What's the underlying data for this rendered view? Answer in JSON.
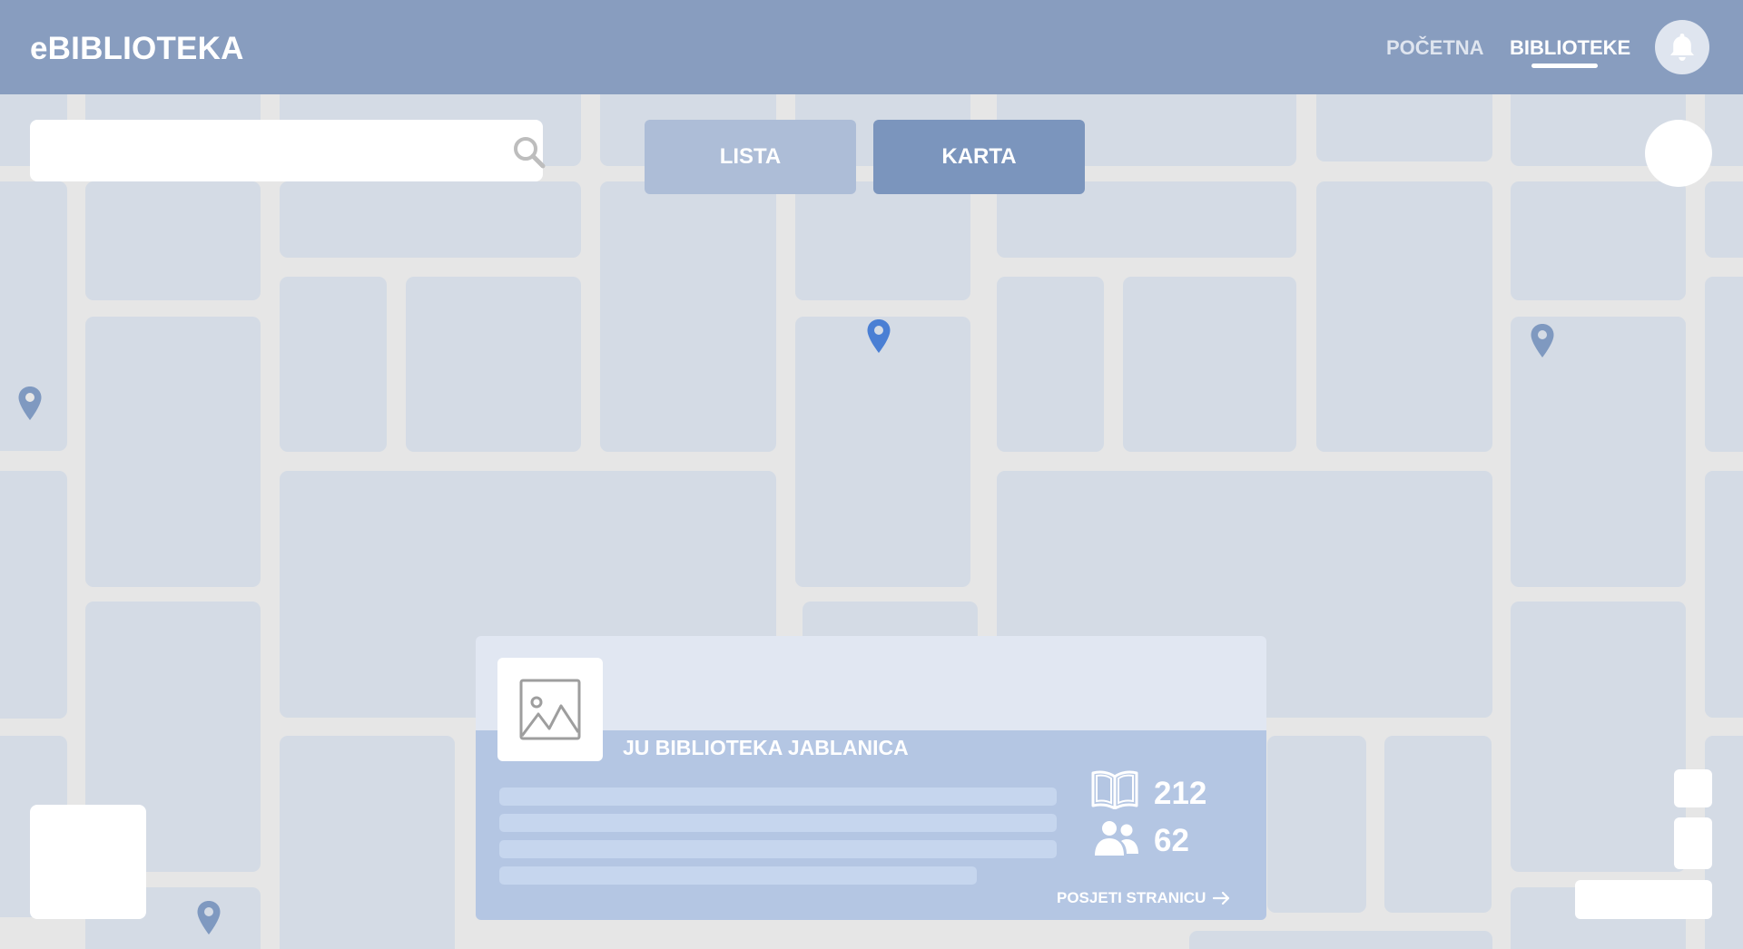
{
  "header": {
    "logo": "eBIBLIOTEKA",
    "nav": [
      {
        "label": "POČETNA",
        "active": false
      },
      {
        "label": "BIBLIOTEKE",
        "active": true
      }
    ],
    "icon": "bell-icon"
  },
  "search": {
    "value": "",
    "placeholder": "",
    "icon": "search-icon"
  },
  "view_toggle": {
    "lista_label": "LISTA",
    "karta_label": "KARTA",
    "selected": "KARTA"
  },
  "card": {
    "title": "JU BIBLIOTEKA JABLANICA",
    "image_icon": "image-placeholder-icon",
    "stats": {
      "books": {
        "icon": "book-icon",
        "value": "212"
      },
      "members": {
        "icon": "users-icon",
        "value": "62"
      }
    },
    "link_label": "POSJETI STRANICU",
    "link_icon": "arrow-right-icon"
  },
  "colors": {
    "header_bg": "#889dbf",
    "map_bg": "#e6e6e6",
    "map_block": "#d4dbe5",
    "pin_default": "#7f99c0",
    "pin_selected": "#4a7fd4",
    "toggle_inactive": "#adbdd7",
    "toggle_active": "#7b95bd",
    "card_top": "#e1e7f2",
    "card_bottom": "#b4c6e3"
  }
}
